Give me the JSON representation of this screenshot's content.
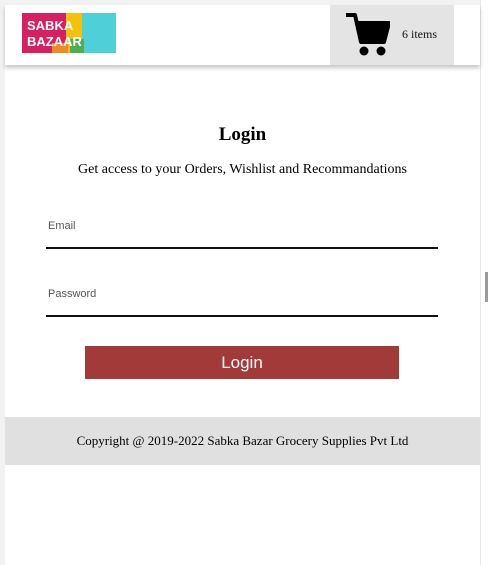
{
  "header": {
    "logo_line1": "SABKA",
    "logo_line2": "BAZAAR",
    "cart_icon": "shopping-cart-icon",
    "cart_count_label": "6 items"
  },
  "login": {
    "title": "Login",
    "subtitle": "Get access to your Orders, Wishlist and Recommandations",
    "email_label": "Email",
    "email_value": "",
    "password_label": "Password",
    "password_value": "",
    "button_label": "Login"
  },
  "footer": {
    "copyright": "Copyright @ 2019-2022 Sabka Bazar Grocery Supplies Pvt Ltd"
  },
  "colors": {
    "brand_button": "#a33a3a",
    "header_cart_bg": "#e4e4e4",
    "footer_bg": "#e0e0e0",
    "logo_pink": "#d81f5f",
    "logo_yellow": "#f4c20d",
    "logo_teal": "#4fd0d8",
    "logo_green": "#4caf50",
    "logo_orange": "#f08a24"
  }
}
